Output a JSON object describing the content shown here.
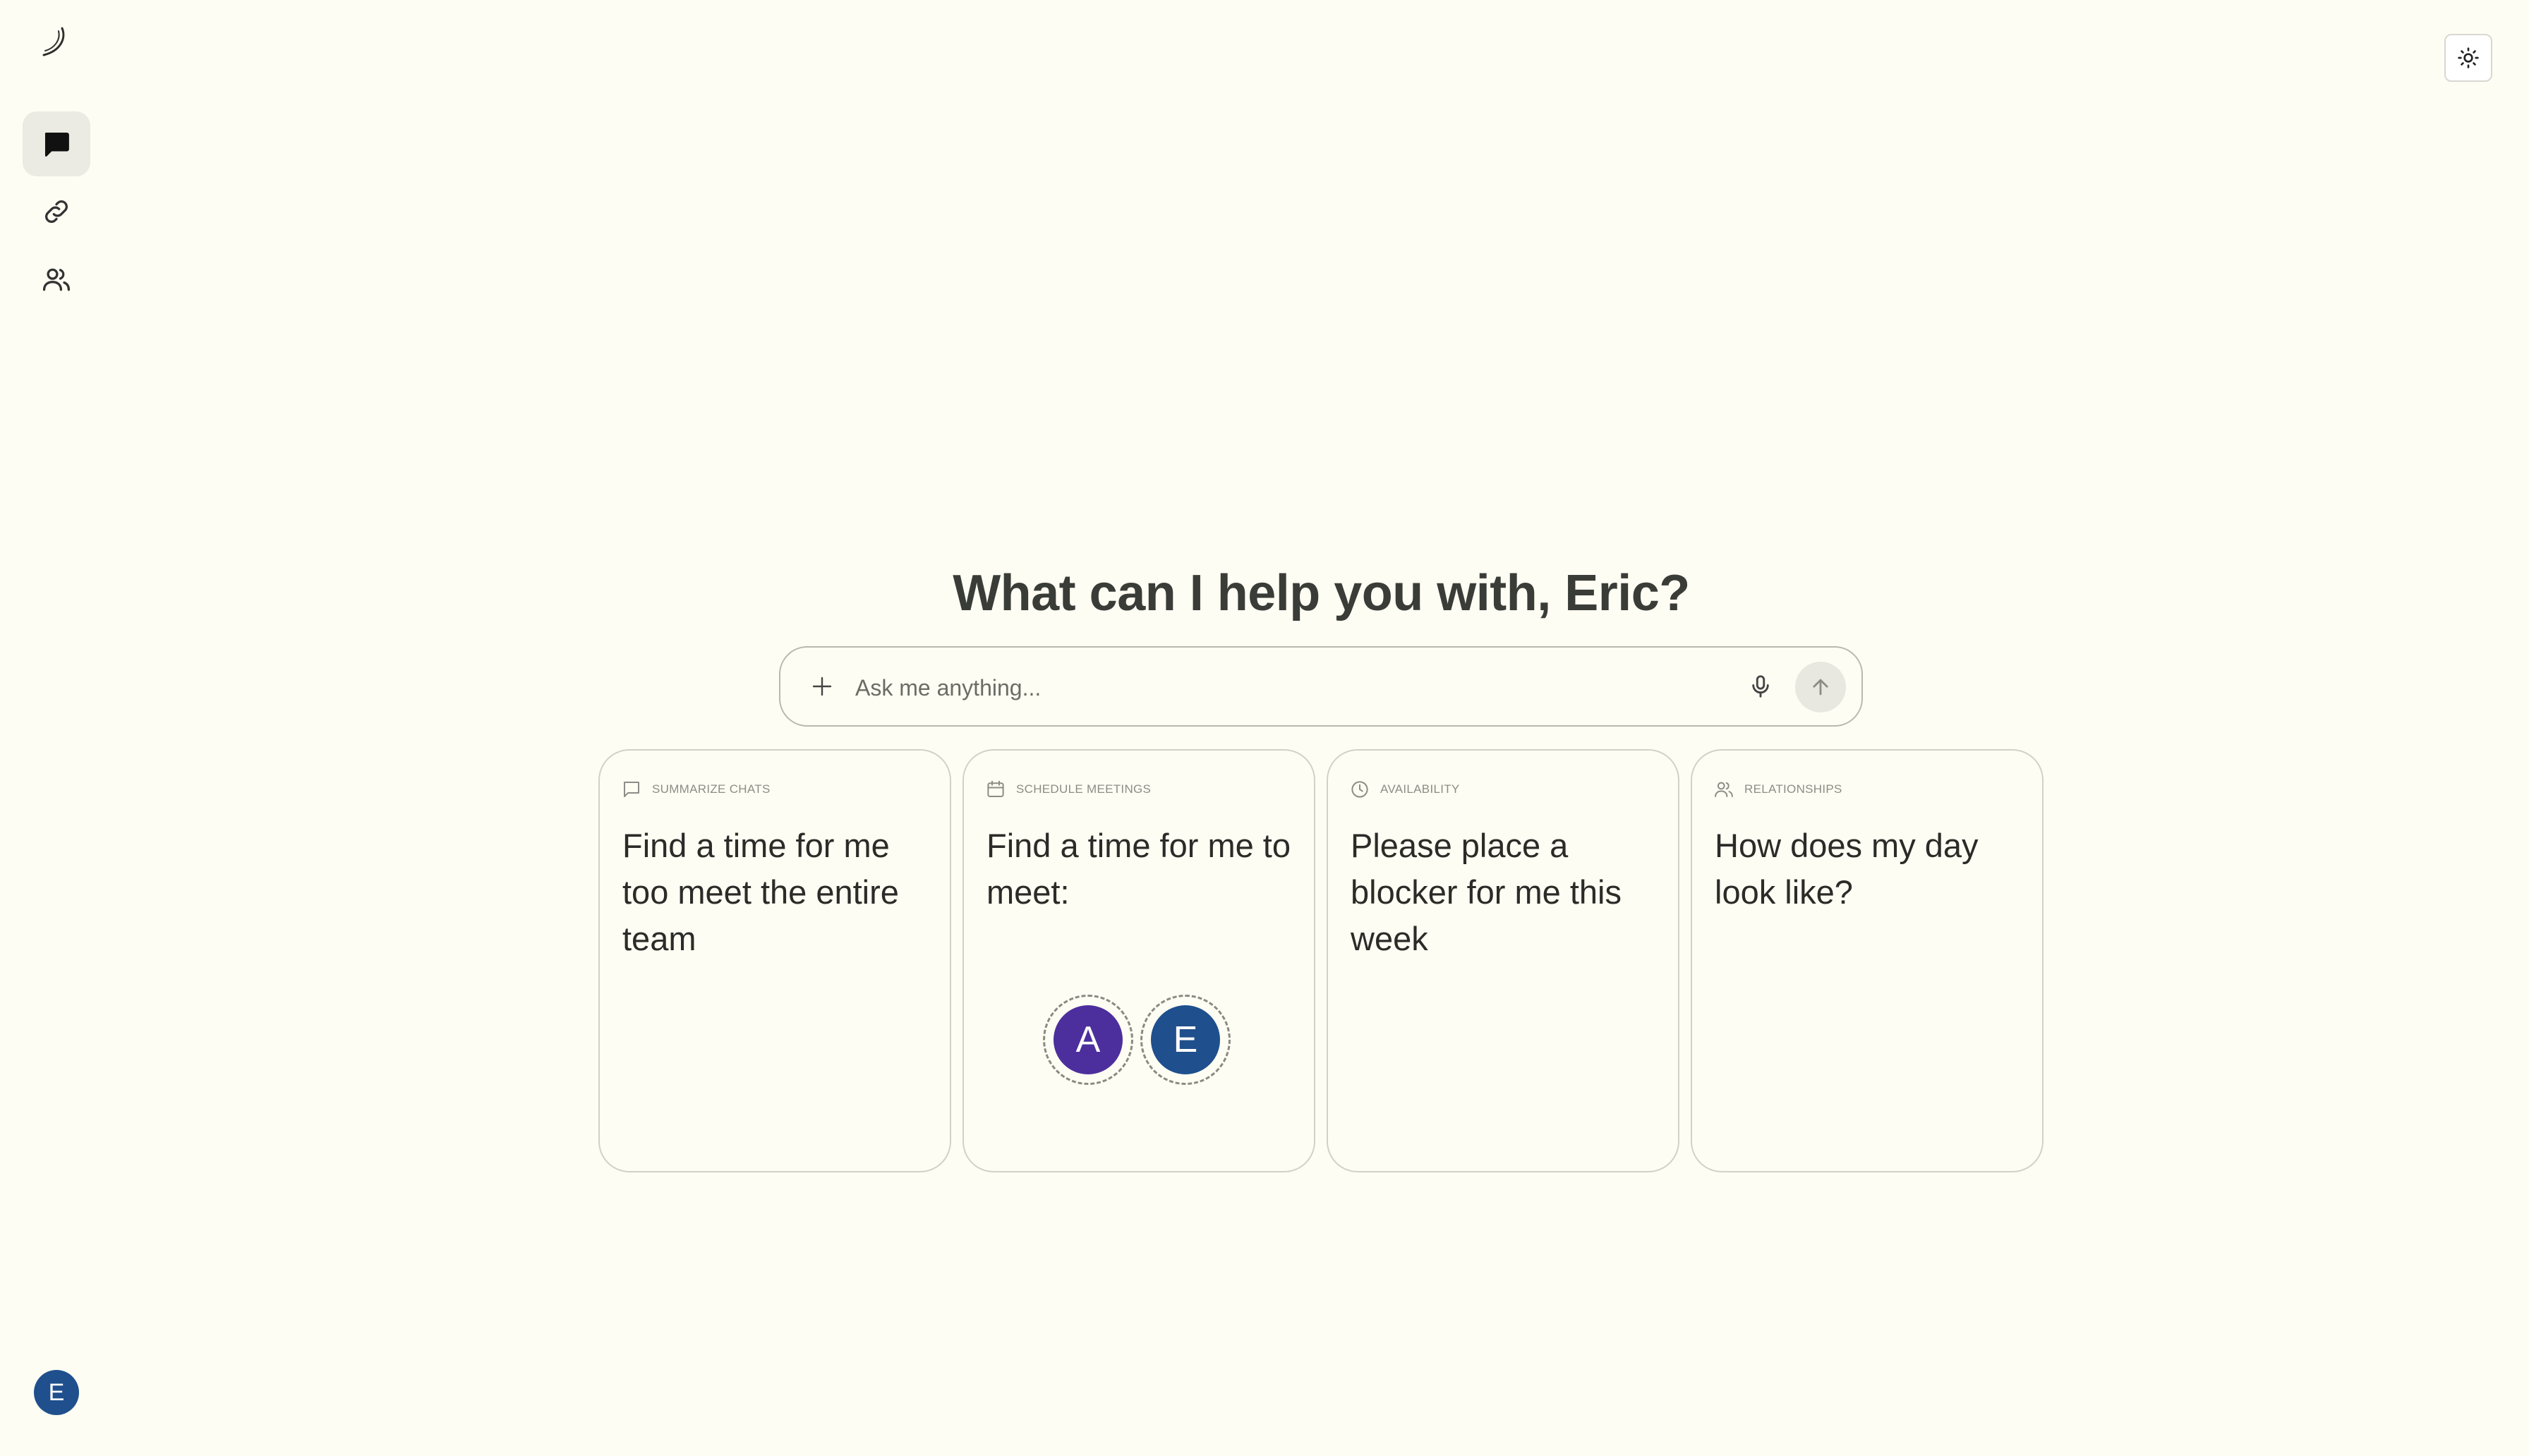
{
  "user": {
    "initial": "E"
  },
  "main": {
    "heading": "What can I help you with, Eric?",
    "search": {
      "placeholder": "Ask me anything..."
    }
  },
  "cards": [
    {
      "category": "SUMMARIZE CHATS",
      "title": "Find a time for me too meet the entire team",
      "icon": "chat-icon"
    },
    {
      "category": "SCHEDULE MEETINGS",
      "title": "Find a time for me to meet:",
      "icon": "calendar-icon",
      "avatars": [
        {
          "initial": "A",
          "color": "#4c2f9c"
        },
        {
          "initial": "E",
          "color": "#1f4f8c"
        }
      ]
    },
    {
      "category": "AVAILABILITY",
      "title": "Please place a blocker for me this week",
      "icon": "clock-icon"
    },
    {
      "category": "RELATIONSHIPS",
      "title": "How does my day look like?",
      "icon": "users-icon"
    }
  ],
  "colors": {
    "background": "#fefdf3",
    "accent_blue": "#1f4f8c",
    "accent_purple": "#4c2f9c"
  }
}
